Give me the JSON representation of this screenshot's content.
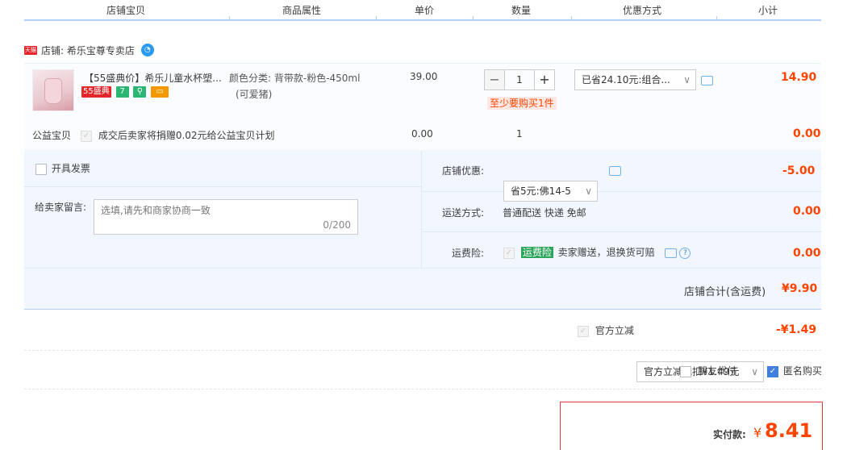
{
  "header": {
    "col_item": "店铺宝贝",
    "col_attr": "商品属性",
    "col_price": "单价",
    "col_qty": "数量",
    "col_discount": "优惠方式",
    "col_subtotal": "小计"
  },
  "shop": {
    "tmall_badge": "天猫",
    "label": "店铺: 希乐宝尊专卖店",
    "wangwang_icon": "wangwang-icon"
  },
  "item": {
    "title": "【55盛典价】希乐儿童水杯塑...",
    "badge_55": "55盛典",
    "badge_7": "7",
    "attr_line1": "颜色分类: 背带款-粉色-450ml",
    "attr_line2": "(可爱猪)",
    "unit_price": "39.00",
    "quantity": "1",
    "minus": "−",
    "plus": "+",
    "min_notice": "至少要购买1件",
    "discount_select": "已省24.10元:组合...",
    "subtotal": "14.90"
  },
  "charity": {
    "label": "公益宝贝",
    "text": "成交后卖家将捐赠0.02元给公益宝贝计划",
    "price": "0.00",
    "qty": "1",
    "subtotal": "0.00"
  },
  "invoice": {
    "label": "开具发票"
  },
  "message": {
    "label": "给卖家留言:",
    "placeholder": "选填,请先和商家协商一致",
    "counter": "0/200"
  },
  "shop_discount": {
    "label": "店铺优惠:",
    "select": "省5元:佛14-5",
    "amount": "-5.00"
  },
  "shipping": {
    "label": "运送方式:",
    "text": "普通配送 快递 免邮",
    "amount": "0.00"
  },
  "insurance": {
    "label": "运费险:",
    "badge": "运费险",
    "text": "卖家赠送，退换货可赔",
    "amount": "0.00"
  },
  "shop_total": {
    "label": "店铺合计(含运费)",
    "amount": "¥9.90"
  },
  "official": {
    "label": "官方立减",
    "select": "官方立减抵扣¥1.49元",
    "amount": "-¥1.49"
  },
  "options": {
    "friend_pay": "朋友代付",
    "anonymous": "匿名购买"
  },
  "final": {
    "label": "实付款:",
    "currency": "¥",
    "amount": "8.41"
  },
  "colors": {
    "accent": "#ff4400",
    "blue_border": "#b2d1ff",
    "light_bg": "#f2f7ff"
  }
}
